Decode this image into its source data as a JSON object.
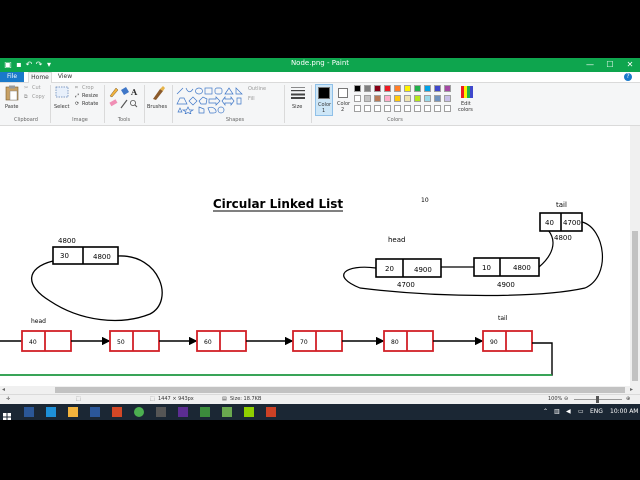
{
  "window": {
    "title": "Node.png - Paint",
    "controls": [
      "—",
      "☐",
      "✕"
    ]
  },
  "ribbon": {
    "tabs": [
      "File",
      "Home",
      "View"
    ],
    "clipboard": {
      "paste": "Paste",
      "cut": "Cut",
      "copy": "Copy",
      "label": "Clipboard"
    },
    "image": {
      "select": "Select",
      "crop": "Crop",
      "resize": "Resize",
      "rotate": "Rotate",
      "label": "Image"
    },
    "tools": {
      "label": "Tools"
    },
    "brushes": {
      "label": "Brushes"
    },
    "shapes": {
      "outline": "Outline",
      "fill": "Fill",
      "label": "Shapes"
    },
    "size": {
      "label": "Size"
    },
    "color1": {
      "line1": "Color",
      "line2": "1"
    },
    "color2": {
      "line1": "Color",
      "line2": "2"
    },
    "colors": {
      "label": "Colors"
    },
    "edit_colors": {
      "line1": "Edit",
      "line2": "colors"
    },
    "palette_row1": [
      "#000000",
      "#7f7f7f",
      "#880015",
      "#ed1c24",
      "#ff7f27",
      "#fff200",
      "#22b14c",
      "#00a2e8",
      "#3f48cc",
      "#a349a4"
    ],
    "palette_row2": [
      "#ffffff",
      "#c3c3c3",
      "#b97a57",
      "#ffaec9",
      "#ffc90e",
      "#efe4b0",
      "#b5e61d",
      "#99d9ea",
      "#7092be",
      "#c8bfe7"
    ]
  },
  "canvas": {
    "title": "Circular Linked List",
    "stray_label": "10",
    "single_node": {
      "data": "30",
      "next": "4800",
      "addr": "4800"
    },
    "list1": {
      "head_label": "head",
      "tail_label": "tail",
      "nodes": [
        {
          "data": "20",
          "next": "4900",
          "addr": "4700"
        },
        {
          "data": "10",
          "next": "4800",
          "addr": "4900"
        },
        {
          "data": "40",
          "next": "4700",
          "addr": "4800"
        }
      ]
    },
    "list2": {
      "head_label": "head",
      "tail_label": "tail",
      "values": [
        "40",
        "50",
        "60",
        "70",
        "80",
        "90"
      ]
    }
  },
  "status": {
    "dimensions": "1447 × 943px",
    "size": "Size: 18.7KB",
    "zoom": "100%"
  },
  "taskbar": {
    "lang": "ENG",
    "time": "10:00 AM"
  }
}
